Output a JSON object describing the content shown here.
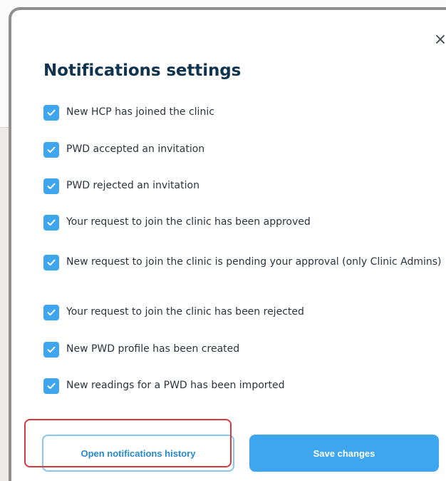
{
  "modal": {
    "title": "Notifications settings",
    "close_icon": "×"
  },
  "notifications": {
    "items": [
      {
        "label": "New HCP has joined the clinic",
        "checked": true
      },
      {
        "label": "PWD accepted an invitation",
        "checked": true
      },
      {
        "label": "PWD rejected an invitation",
        "checked": true
      },
      {
        "label": "Your request to join the clinic has been approved",
        "checked": true
      },
      {
        "label": "New request to join the clinic is pending your approval (only Clinic Admins)",
        "checked": true
      },
      {
        "label": "Your request to join the clinic has been rejected",
        "checked": true
      },
      {
        "label": "New PWD profile has been created",
        "checked": true
      },
      {
        "label": "New readings for a PWD has been imported",
        "checked": true
      }
    ]
  },
  "footer": {
    "history_label": "Open notifications history",
    "save_label": "Save changes"
  },
  "colors": {
    "title": "#10344f",
    "accent": "#3ea6ee",
    "highlight": "#d33b43"
  },
  "icons": {
    "close": "close-icon",
    "check": "check-icon"
  }
}
